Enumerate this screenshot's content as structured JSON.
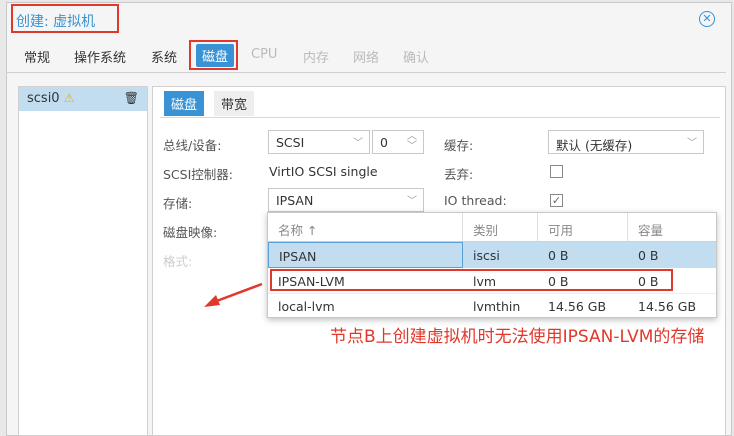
{
  "window": {
    "title": "创建: 虚拟机",
    "close_icon": "close-circle-icon"
  },
  "tabs": [
    "常规",
    "操作系统",
    "系统",
    "磁盘",
    "CPU",
    "内存",
    "网络",
    "确认"
  ],
  "active_tab": "磁盘",
  "disk_list": [
    {
      "label": "scsi0",
      "icon": "warning-icon",
      "action_icon": "trash-icon"
    }
  ],
  "inner_tabs": [
    "磁盘",
    "带宽"
  ],
  "form": {
    "bus_label": "总线/设备:",
    "bus_value": "SCSI",
    "device_value": "0",
    "controller_label": "SCSI控制器:",
    "controller_value": "VirtIO SCSI single",
    "storage_label": "存储:",
    "storage_value": "IPSAN",
    "image_label": "磁盘映像:",
    "format_label": "格式:",
    "cache_label": "缓存:",
    "cache_value": "默认 (无缓存)",
    "discard_label": "丢弃:",
    "discard_checked": false,
    "iothread_label": "IO thread:",
    "iothread_checked": true
  },
  "storage_grid": {
    "columns": [
      "名称 ↑",
      "类别",
      "可用",
      "容量"
    ],
    "rows": [
      [
        "IPSAN",
        "iscsi",
        "0 B",
        "0 B"
      ],
      [
        "IPSAN-LVM",
        "lvm",
        "0 B",
        "0 B"
      ],
      [
        "local-lvm",
        "lvmthin",
        "14.56 GB",
        "14.56 GB"
      ]
    ]
  },
  "annotation": "节点B上创建虚拟机时无法使用IPSAN-LVM的存储",
  "colors": {
    "accent": "#3892d4",
    "highlight": "#e0392b",
    "selected_row": "#c2dcf0"
  }
}
